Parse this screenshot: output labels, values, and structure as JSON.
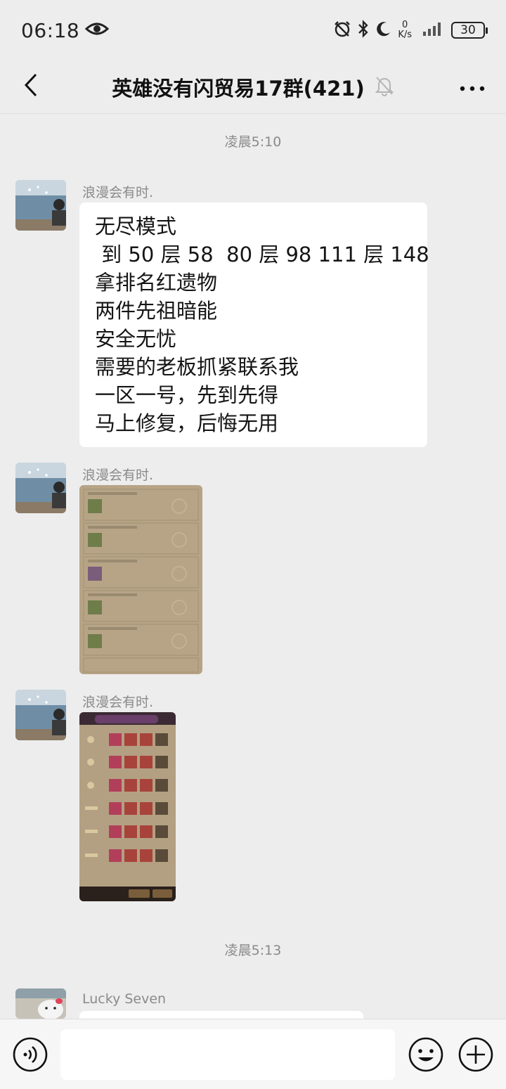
{
  "status_bar": {
    "time": "06:18",
    "net_speed_value": "0",
    "net_speed_unit": "K/s",
    "battery": "30"
  },
  "header": {
    "title": "英雄没有闪贸易17群(421)"
  },
  "timestamps": [
    "凌晨5:10",
    "凌晨5:13"
  ],
  "messages": [
    {
      "sender": "浪漫会有时.",
      "type": "text",
      "lines": [
        "无尽模式",
        " 到 50 层 58  80 层 98 111 层 148",
        "拿排名红遗物",
        "两件先祖暗能",
        "安全无忧",
        "需要的老板抓紧联系我",
        "一区一号，先到先得",
        "马上修复，后悔无用"
      ]
    },
    {
      "sender": "浪漫会有时.",
      "type": "image"
    },
    {
      "sender": "浪漫会有时.",
      "type": "image"
    },
    {
      "sender": "Lucky Seven",
      "type": "text"
    }
  ],
  "input": {
    "placeholder": ""
  },
  "icons": {
    "status_eye": "eye-icon",
    "alarm": "alarm-icon",
    "bluetooth": "bluetooth-icon",
    "moon": "moon-icon",
    "signal": "signal-icon",
    "back": "chevron-left-icon",
    "mute": "bell-off-icon",
    "more": "more-dots-icon",
    "voice": "voice-icon",
    "emoji": "emoji-icon",
    "plus": "plus-icon"
  },
  "colors": {
    "background": "#ededed",
    "bubble": "#ffffff",
    "meta_text": "#8a8a8a"
  }
}
